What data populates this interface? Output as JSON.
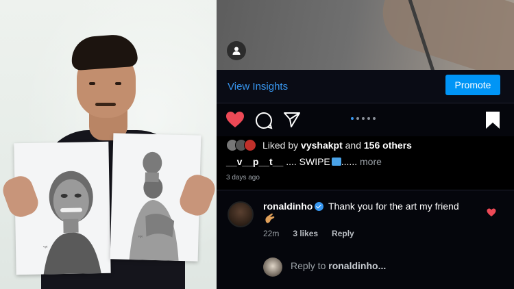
{
  "post_photo": {
    "subject": "person-holding-sketches",
    "sketches": [
      {
        "signature": "vpt"
      },
      {
        "signature": "vpt"
      }
    ]
  },
  "media_preview": {
    "tag_icon": "user-tag-icon"
  },
  "insights": {
    "view_insights_label": "View Insights",
    "promote_label": "Promote"
  },
  "actions": {
    "like_icon": "heart-filled-icon",
    "comment_icon": "comment-bubble-icon",
    "share_icon": "paper-plane-icon",
    "save_icon": "bookmark-filled-icon",
    "carousel_dots": 5,
    "carousel_active_index": 0
  },
  "likes": {
    "prefix": "Liked by",
    "first_user": "vyshakpt",
    "joiner": "and",
    "others": "156 others"
  },
  "caption": {
    "username": "__v__p__t__",
    "text": ".... SWIPE",
    "trail": "......",
    "more_label": "more"
  },
  "time_ago": "3 days ago",
  "comment": {
    "username": "ronaldinho",
    "verified": true,
    "text": "Thank you for the art my friend",
    "emoji": "hand-emoji",
    "age": "22m",
    "likes": "3 likes",
    "reply_label": "Reply"
  },
  "reply_box": {
    "prefix": "Reply to",
    "target": "ronaldinho..."
  },
  "colors": {
    "accent_blue": "#3897f0",
    "promote_blue": "#0095f6",
    "heart_red": "#ed4956",
    "background": "#000000"
  }
}
